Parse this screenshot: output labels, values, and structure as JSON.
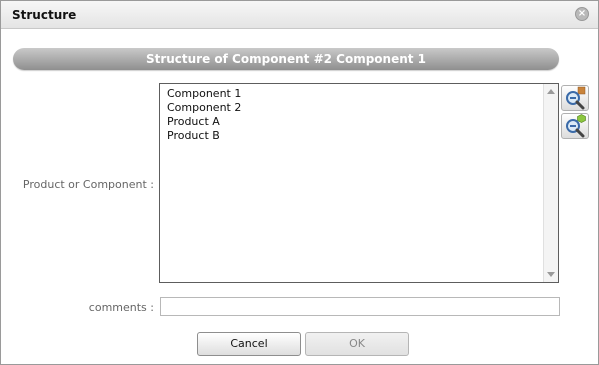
{
  "dialog": {
    "title": "Structure",
    "close_icon": "close-icon"
  },
  "banner": {
    "text": "Structure of Component #2 Component 1"
  },
  "form": {
    "product_label": "Product or Component :",
    "list_items": [
      "Component 1",
      "Component 2",
      "Product A",
      "Product B"
    ],
    "search_component_icon": "search-component-icon",
    "search_product_icon": "search-product-icon",
    "comments_label": "comments :",
    "comments_value": ""
  },
  "buttons": {
    "cancel": "Cancel",
    "ok": "OK"
  }
}
